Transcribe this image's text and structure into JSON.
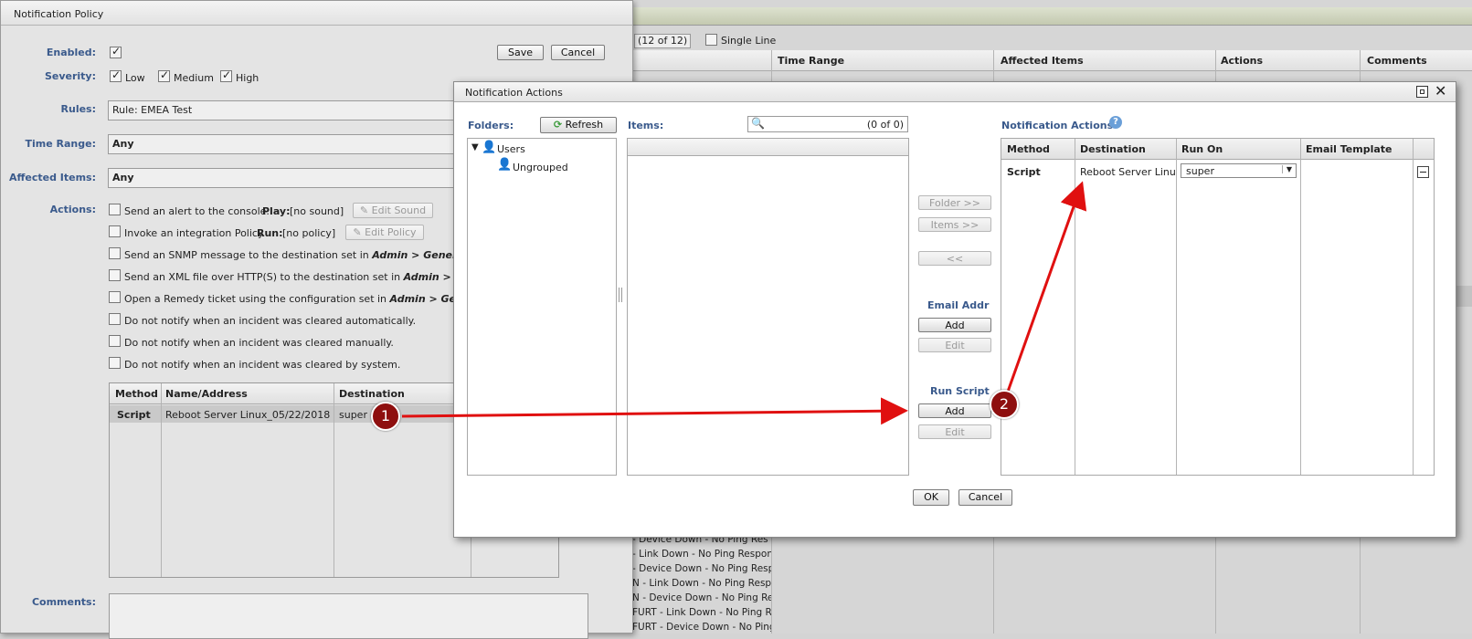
{
  "bg": {
    "counter": "(12 of 12)",
    "single_line": "Single Line",
    "cols": [
      "Time Range",
      "Affected Items",
      "Actions",
      "Comments"
    ],
    "rows": [
      "- Device Down - No Ping Res",
      "- Link Down - No Ping Response",
      "- Device Down - No Ping Respo",
      "N - Link Down - No Ping Respo",
      "N - Device Down - No Ping Res",
      "FURT - Link Down - No Ping Re",
      "FURT - Device Down - No Ping"
    ]
  },
  "policy": {
    "title": "Notification Policy",
    "save": "Save",
    "cancel": "Cancel",
    "labels": {
      "enabled": "Enabled:",
      "severity": "Severity:",
      "rules": "Rules:",
      "time_range": "Time Range:",
      "affected": "Affected Items:",
      "actions": "Actions:",
      "comments": "Comments:"
    },
    "severity": [
      "Low",
      "Medium",
      "High"
    ],
    "rules_value": "Rule: EMEA Test",
    "time_range_value": "Any",
    "affected_value": "Any",
    "actions": {
      "a1": "Send an alert to the console.",
      "play_label": "Play:",
      "play_value": "[no sound]",
      "edit_sound": "Edit Sound",
      "a2": "Invoke an integration Policy.",
      "run_label": "Run:",
      "run_value": "[no policy]",
      "edit_policy": "Edit Policy",
      "a3_pre": "Send an SNMP message to the destination set in ",
      "a3_b": "Admin > General Settin",
      "a4_pre": "Send an XML file over HTTP(S) to the destination set in ",
      "a4_b": "Admin > General",
      "a5_pre": "Open a Remedy ticket using the configuration set in ",
      "a5_b": "Admin > General Se",
      "a6": "Do not notify when an incident was cleared automatically.",
      "a7": "Do not notify when an incident was cleared manually.",
      "a8": "Do not notify when an incident was cleared by system."
    },
    "table": {
      "cols": [
        "Method",
        "Name/Address",
        "Destination"
      ],
      "row": [
        "Script",
        "Reboot Server Linux_05/22/2018",
        "super"
      ]
    }
  },
  "dialog": {
    "title": "Notification Actions",
    "folders_label": "Folders:",
    "refresh": "Refresh",
    "items_label": "Items:",
    "items_count": "(0 of 0)",
    "tree": {
      "users": "Users",
      "ungrouped": "Ungrouped"
    },
    "folder_btn": "Folder >>",
    "items_btn": "Items >>",
    "back_btn": "<<",
    "email_addr": "Email Addr",
    "add": "Add",
    "edit": "Edit",
    "run_script": "Run Script",
    "na_label": "Notification Actions",
    "na_cols": [
      "Method",
      "Destination",
      "Run On",
      "Email Template"
    ],
    "na_row": {
      "method": "Script",
      "destination": "Reboot Server Linux_",
      "run_on": "super"
    },
    "ok": "OK",
    "cancel": "Cancel"
  },
  "callouts": [
    "1",
    "2"
  ]
}
